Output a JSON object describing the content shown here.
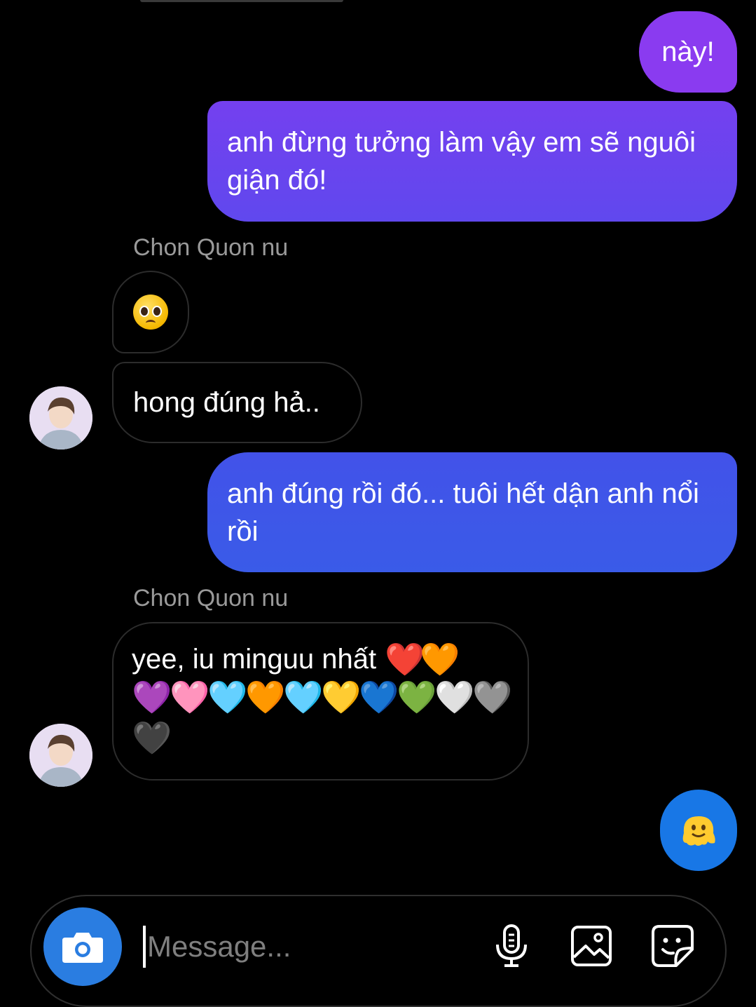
{
  "colors": {
    "outgoing_top": "#8c3bf0",
    "outgoing_mid": "#6a44ee",
    "outgoing_bottom": "#3d5ae8",
    "accent_blue": "#2a7de1"
  },
  "messages": [
    {
      "from": "me",
      "text": "này!"
    },
    {
      "from": "me",
      "text": "anh đừng tưởng làm vậy em sẽ nguôi giận đó!"
    },
    {
      "from": "them",
      "sender": "Chon Quon nu",
      "emoji": "pleading-face"
    },
    {
      "from": "them",
      "text": "hong đúng hả.."
    },
    {
      "from": "me",
      "text": "anh đúng rồi đó... tuôi hết dận anh nổi rồi"
    },
    {
      "from": "them",
      "sender": "Chon Quon nu",
      "text": "yee, iu minguu nhất",
      "hearts": [
        "❤️",
        "🧡",
        "💜",
        "🩷",
        "🩵",
        "🧡",
        "🩵",
        "💛",
        "💙",
        "💚",
        "🤍",
        "🩶",
        "🖤"
      ]
    },
    {
      "from": "me",
      "emoji": "melting-face"
    }
  ],
  "composer": {
    "placeholder": "Message...",
    "icons": [
      "camera-icon",
      "microphone-icon",
      "gallery-icon",
      "sticker-icon"
    ]
  }
}
